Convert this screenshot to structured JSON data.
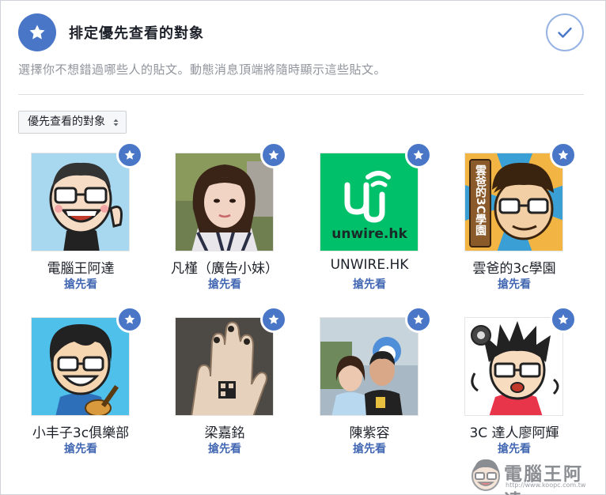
{
  "header": {
    "title": "排定優先查看的對象",
    "subtitle": "選擇你不想錯過哪些人的貼文。動態消息頂端將隨時顯示這些貼文。"
  },
  "filter": {
    "selected": "優先查看的對象"
  },
  "people": [
    {
      "name": "電腦王阿達",
      "action": "搶先看"
    },
    {
      "name": "凡槿（廣告小妹）",
      "action": "搶先看"
    },
    {
      "name": "UNWIRE.HK",
      "action": "搶先看"
    },
    {
      "name": "雲爸的3c學園",
      "action": "搶先看"
    },
    {
      "name": "小丰子3c俱樂部",
      "action": "搶先看"
    },
    {
      "name": "梁嘉銘",
      "action": "搶先看"
    },
    {
      "name": "陳紫容",
      "action": "搶先看"
    },
    {
      "name": "3C 達人廖阿輝",
      "action": "搶先看"
    }
  ],
  "logos": {
    "unwire": "unwire.hk",
    "yunba": "雲爸的3C學園"
  },
  "watermark": {
    "text": "電腦王阿達",
    "url": "http://www.koopc.com.tw"
  },
  "colors": {
    "accent": "#4a76c8",
    "link": "#4267b2",
    "unwire_green": "#00c06a"
  },
  "icons": {
    "header": "star-icon",
    "done": "checkmark-icon",
    "badge": "star-icon",
    "dropdown": "sort-caret-icon"
  }
}
